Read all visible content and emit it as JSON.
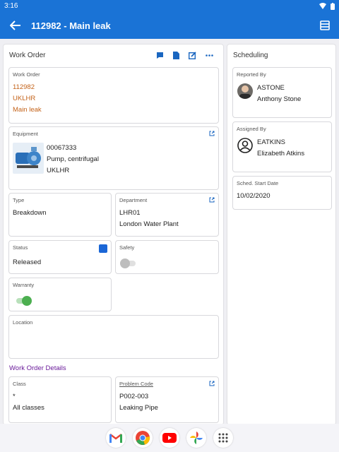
{
  "status_bar": {
    "time": "3:16"
  },
  "app_bar": {
    "title": "112982 - Main leak"
  },
  "work_order_panel": {
    "heading": "Work Order",
    "summary": {
      "label": "Work Order",
      "number": "112982",
      "org": "UKLHR",
      "description": "Main leak"
    },
    "equipment": {
      "label": "Equipment",
      "code": "00067333",
      "name": "Pump, centrifugal",
      "org": "UKLHR"
    },
    "type": {
      "label": "Type",
      "value": "Breakdown"
    },
    "department": {
      "label": "Department",
      "code": "LHR01",
      "name": "London Water Plant"
    },
    "status": {
      "label": "Status",
      "value": "Released",
      "color": "#1a66d6"
    },
    "safety": {
      "label": "Safety",
      "on": false
    },
    "warranty": {
      "label": "Warranty",
      "on": true
    },
    "location": {
      "label": "Location",
      "value": ""
    }
  },
  "details_section": {
    "title": "Work Order Details",
    "class": {
      "label": "Class",
      "code": "*",
      "name": "All classes"
    },
    "problem_code": {
      "label": "Problem Code",
      "code": "P002-003",
      "name": "Leaking Pipe"
    }
  },
  "scheduling_panel": {
    "heading": "Scheduling",
    "reported_by": {
      "label": "Reported By",
      "code": "ASTONE",
      "name": "Anthony Stone"
    },
    "assigned_by": {
      "label": "Assigned By",
      "code": "EATKINS",
      "name": "Elizabeth Atkins"
    },
    "sched_start": {
      "label": "Sched. Start Date",
      "value": "10/02/2020"
    }
  },
  "icons": {
    "back": "arrow-left-icon",
    "menu": "menu-icon",
    "comment": "comment-icon",
    "document": "document-icon",
    "edit": "edit-icon",
    "more": "more-icon",
    "external": "open-external-icon",
    "avatar": "person-icon",
    "dock": [
      "gmail-icon",
      "chrome-icon",
      "youtube-icon",
      "photos-icon",
      "app-drawer-icon"
    ]
  },
  "colors": {
    "accent": "#1a73d6",
    "link": "#c4631a",
    "section": "#6a1b9a",
    "toggle_on": "#4caf50"
  }
}
